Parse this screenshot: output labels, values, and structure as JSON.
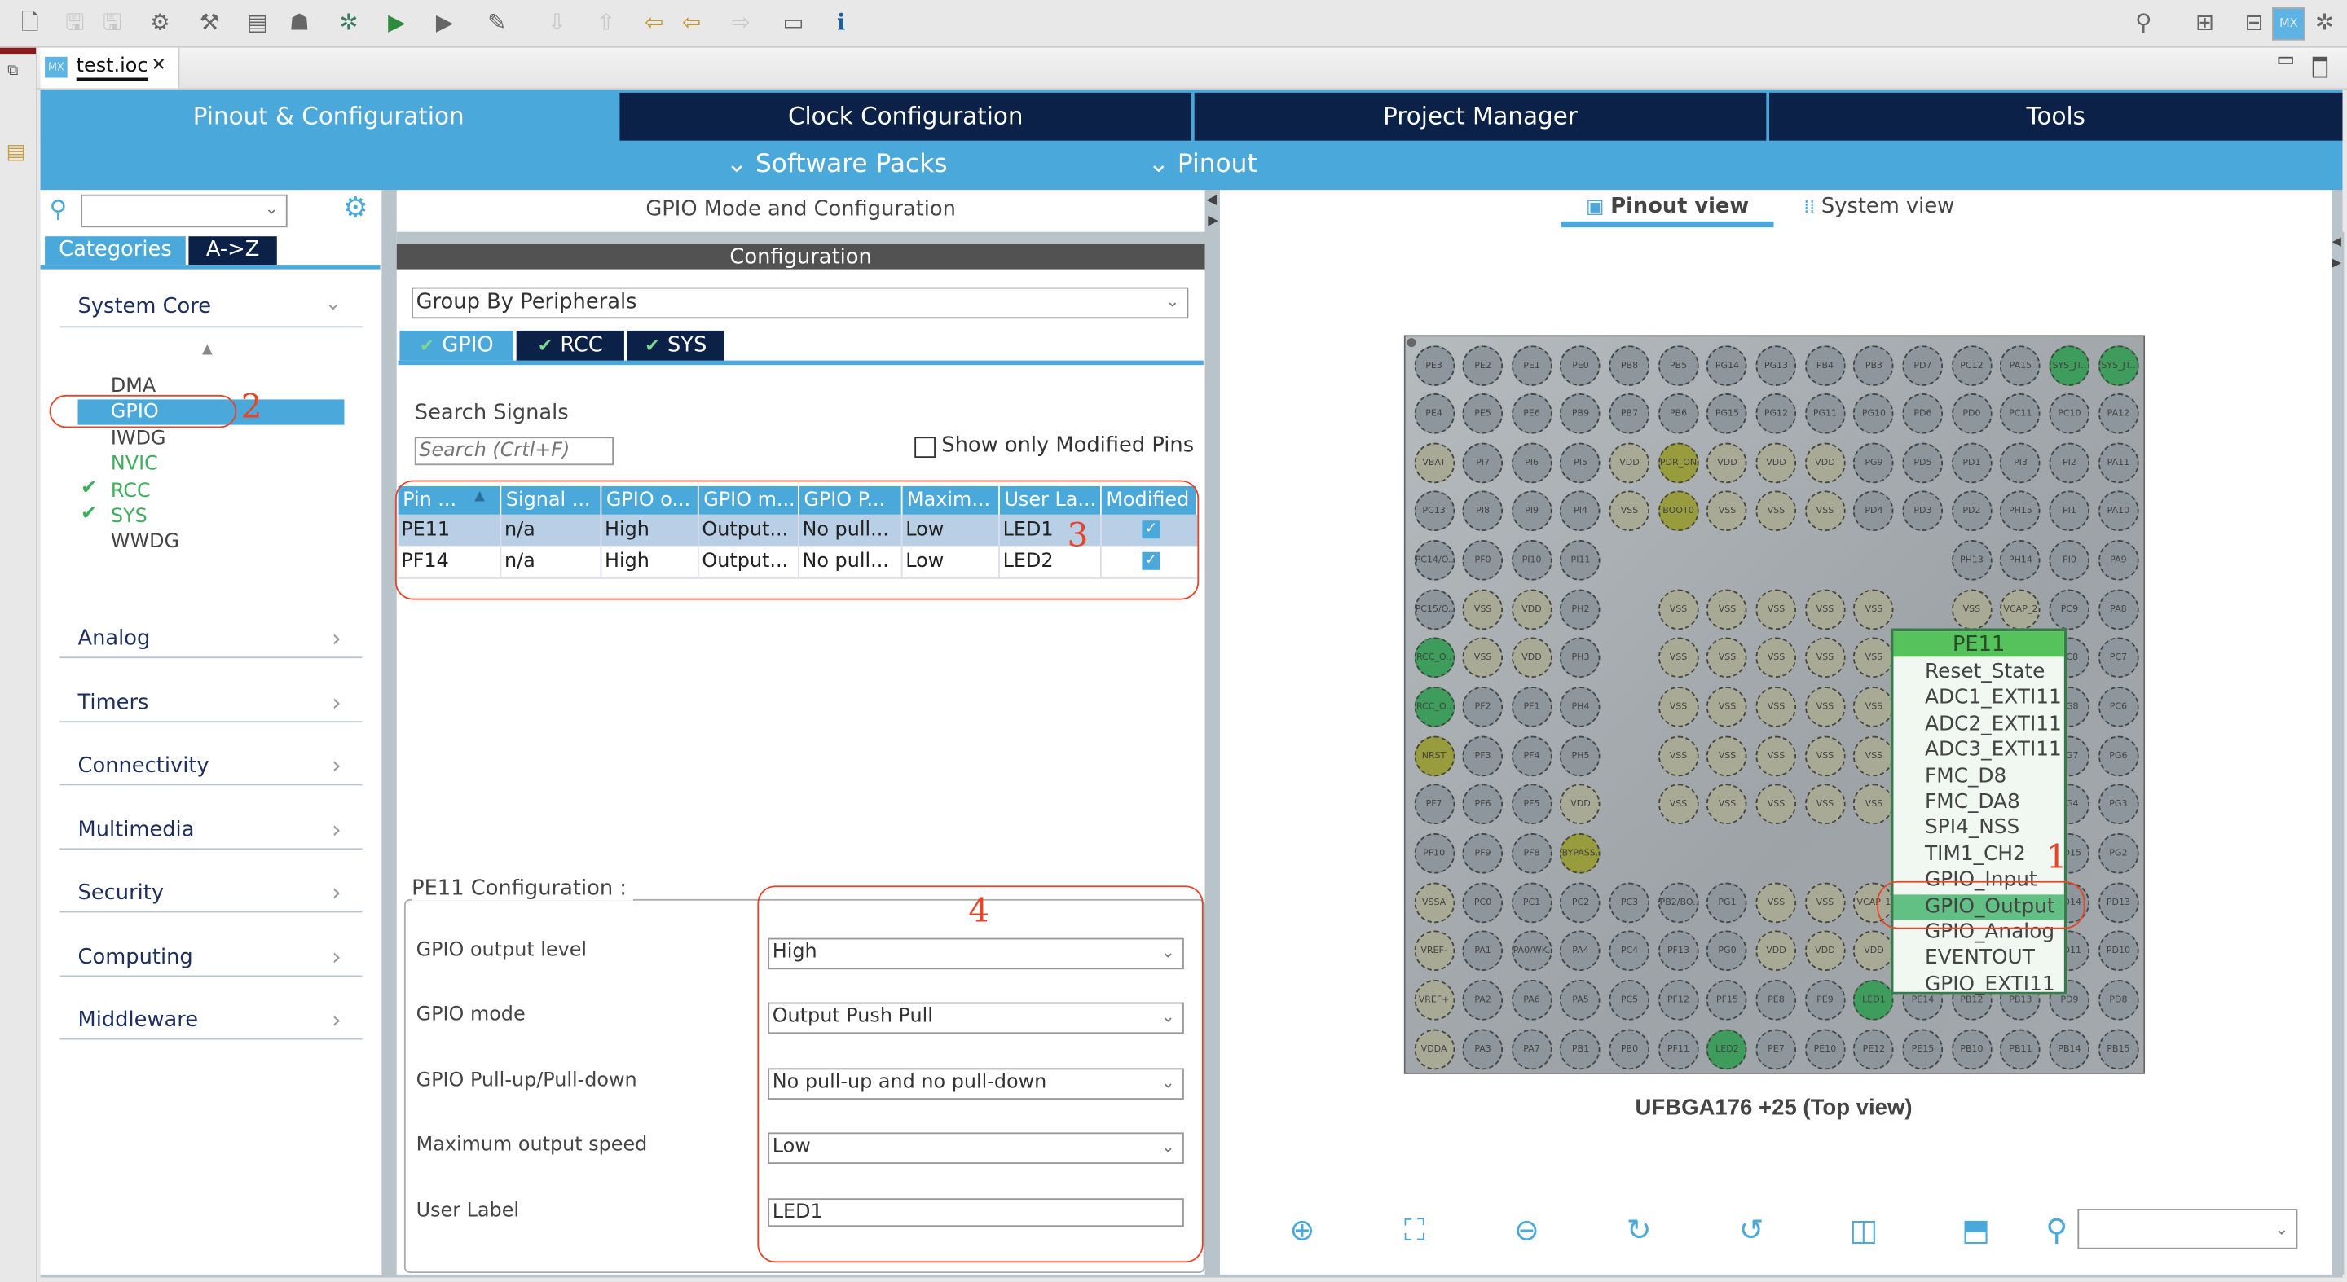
{
  "toolbar": {
    "icons": [
      "new-icon",
      "save-icon",
      "save-all-icon",
      "build-config-icon",
      "hammer-icon",
      "binary-icon",
      "toggle-icon",
      "debug-icon",
      "run-icon",
      "external-tools-icon",
      "pen-icon",
      "next-annotation-icon",
      "prev-annotation-icon",
      "last-edit-icon",
      "back-icon",
      "forward-icon",
      "open-perspective-icon",
      "info-icon"
    ],
    "right_icons": [
      "search-icon",
      "perspective-icon",
      "cpp-perspective-icon",
      "mx-perspective-icon",
      "debug-perspective-icon"
    ]
  },
  "editor_tab": {
    "badge": "MX",
    "title": "test.ioc"
  },
  "nav": {
    "tabs": [
      {
        "label": "Pinout & Configuration",
        "active": true
      },
      {
        "label": "Clock Configuration",
        "active": false
      },
      {
        "label": "Project Manager",
        "active": false
      },
      {
        "label": "Tools",
        "active": false
      }
    ],
    "sub": {
      "software_packs": "Software Packs",
      "pinout": "Pinout"
    }
  },
  "left": {
    "search_value": "",
    "tabs": {
      "categories": "Categories",
      "az": "A->Z"
    },
    "system_core": {
      "label": "System Core",
      "items": [
        {
          "label": "DMA",
          "checked": false,
          "green": false
        },
        {
          "label": "GPIO",
          "checked": false,
          "green": false,
          "selected": true
        },
        {
          "label": "IWDG",
          "checked": false,
          "green": false
        },
        {
          "label": "NVIC",
          "checked": false,
          "green": true
        },
        {
          "label": "RCC",
          "checked": true,
          "green": true
        },
        {
          "label": "SYS",
          "checked": true,
          "green": true
        },
        {
          "label": "WWDG",
          "checked": false,
          "green": false
        }
      ]
    },
    "categories": [
      "Analog",
      "Timers",
      "Connectivity",
      "Multimedia",
      "Security",
      "Computing",
      "Middleware"
    ]
  },
  "middle": {
    "title": "GPIO Mode and Configuration",
    "config_header": "Configuration",
    "group_by": "Group By Peripherals",
    "tabs": [
      {
        "label": "GPIO",
        "active": true
      },
      {
        "label": "RCC",
        "active": false
      },
      {
        "label": "SYS",
        "active": false
      }
    ],
    "search_label": "Search Signals",
    "search_placeholder": "Search (Crtl+F)",
    "show_modified_label": "Show only Modified Pins",
    "show_modified_checked": false,
    "table": {
      "columns": [
        "Pin ...",
        "Signal ...",
        "GPIO o...",
        "GPIO m...",
        "GPIO P...",
        "Maxim...",
        "User La...",
        "Modified"
      ],
      "rows": [
        {
          "cells": [
            "PE11",
            "n/a",
            "High",
            "Output...",
            "No pull...",
            "Low",
            "LED1"
          ],
          "modified": true,
          "selected": true
        },
        {
          "cells": [
            "PF14",
            "n/a",
            "High",
            "Output...",
            "No pull...",
            "Low",
            "LED2"
          ],
          "modified": true,
          "selected": false
        }
      ]
    },
    "pin_config": {
      "legend": "PE11 Configuration :",
      "fields": [
        {
          "label": "GPIO output level",
          "value": "High",
          "type": "select"
        },
        {
          "label": "GPIO mode",
          "value": "Output Push Pull",
          "type": "select"
        },
        {
          "label": "GPIO Pull-up/Pull-down",
          "value": "No pull-up and no pull-down",
          "type": "select"
        },
        {
          "label": "Maximum output speed",
          "value": "Low",
          "type": "select"
        },
        {
          "label": "User Label",
          "value": "LED1",
          "type": "text"
        }
      ]
    }
  },
  "annotations": [
    "1",
    "2",
    "3",
    "4"
  ],
  "right": {
    "tabs": {
      "pinout_view": "Pinout view",
      "system_view": "System view"
    },
    "package_label": "UFBGA176 +25 (Top view)",
    "bottom_icons": [
      "zoom-in-icon",
      "fit-icon",
      "zoom-out-icon",
      "rotate-right-icon",
      "rotate-left-icon",
      "flip-vertical-icon",
      "flip-horizontal-icon",
      "find-icon"
    ],
    "find_value": ""
  },
  "chip": {
    "colors": {
      "default": "#8c969c",
      "power": "#a9aa96",
      "special": "#989c3c",
      "assigned": "#3e9c5c",
      "background": "#a4aaad"
    },
    "assigned_pins": [
      "SYS_JT..",
      "RCC_O..",
      "LED1",
      "LED2"
    ],
    "special_pins": [
      "PDR_ON",
      "BOOT0",
      "NRST",
      "BYPASS.."
    ],
    "rows": [
      [
        "PE3",
        "PE2",
        "PE1",
        "PE0",
        "PB8",
        "PB5",
        "PG14",
        "PG13",
        "PB4",
        "PB3",
        "PD7",
        "PC12",
        "PA15",
        "SYS_JT..",
        "SYS_JT.."
      ],
      [
        "PE4",
        "PE5",
        "PE6",
        "PB9",
        "PB7",
        "PB6",
        "PG15",
        "PG12",
        "PG11",
        "PG10",
        "PD6",
        "PD0",
        "PC11",
        "PC10",
        "PA12"
      ],
      [
        "VBAT",
        "PI7",
        "PI6",
        "PI5",
        "VDD",
        "PDR_ON",
        "VDD",
        "VDD",
        "VDD",
        "PG9",
        "PD5",
        "PD1",
        "PI3",
        "PI2",
        "PA11"
      ],
      [
        "PC13",
        "PI8",
        "PI9",
        "PI4",
        "VSS",
        "BOOT0",
        "VSS",
        "VSS",
        "VSS",
        "PD4",
        "PD3",
        "PD2",
        "PH15",
        "PI1",
        "PA10"
      ],
      [
        "PC14/O..",
        "PF0",
        "PI10",
        "PI11",
        "",
        "",
        "",
        "",
        "",
        "",
        "",
        "PH13",
        "PH14",
        "PI0",
        "PA9"
      ],
      [
        "PC15/O..",
        "VSS",
        "VDD",
        "PH2",
        "",
        "VSS",
        "VSS",
        "VSS",
        "VSS",
        "VSS",
        "",
        "VSS",
        "VCAP_2",
        "PC9",
        "PA8"
      ],
      [
        "RCC_O..",
        "VSS",
        "VDD",
        "PH3",
        "",
        "VSS",
        "VSS",
        "VSS",
        "VSS",
        "VSS",
        null,
        null,
        null,
        "PC8",
        "PC7"
      ],
      [
        "RCC_O..",
        "PF2",
        "PF1",
        "PH4",
        "",
        "VSS",
        "VSS",
        "VSS",
        "VSS",
        "VSS",
        null,
        null,
        null,
        "PG8",
        "PC6"
      ],
      [
        "NRST",
        "PF3",
        "PF4",
        "PH5",
        "",
        "VSS",
        "VSS",
        "VSS",
        "VSS",
        "VSS",
        null,
        null,
        null,
        "PG7",
        "PG6"
      ],
      [
        "PF7",
        "PF6",
        "PF5",
        "VDD",
        "",
        "VSS",
        "VSS",
        "VSS",
        "VSS",
        "VSS",
        null,
        null,
        null,
        "PG4",
        "PG3"
      ],
      [
        "PF10",
        "PF9",
        "PF8",
        "BYPASS..",
        "",
        "",
        "",
        "",
        "",
        "",
        null,
        null,
        null,
        "PD15",
        "PG2"
      ],
      [
        "VSSA",
        "PC0",
        "PC1",
        "PC2",
        "PC3",
        "PB2/BO..",
        "PG1",
        "VSS",
        "VSS",
        "VCAP_1",
        null,
        null,
        null,
        "PD14",
        "PD13"
      ],
      [
        "VREF-",
        "PA1",
        "PA0/WK..",
        "PA4",
        "PC4",
        "PF13",
        "PG0",
        "VDD",
        "VDD",
        "VDD",
        null,
        null,
        null,
        "PD11",
        "PD10"
      ],
      [
        "VREF+",
        "PA2",
        "PA6",
        "PA5",
        "PC5",
        "PF12",
        "PF15",
        "PE8",
        "PE9",
        "LED1",
        "PE14",
        "PB12",
        "PB13",
        "PD9",
        "PD8"
      ],
      [
        "VDDA",
        "PA3",
        "PA7",
        "PB1",
        "PB0",
        "PF11",
        "LED2",
        "PE7",
        "PE10",
        "PE12",
        "PE15",
        "PB10",
        "PB11",
        "PB14",
        "PB15"
      ]
    ],
    "popup": {
      "title": "PE11",
      "items": [
        "Reset_State",
        "ADC1_EXTI11",
        "ADC2_EXTI11",
        "ADC3_EXTI11",
        "FMC_D8",
        "FMC_DA8",
        "SPI4_NSS",
        "TIM1_CH2",
        "GPIO_Input",
        "GPIO_Output",
        "GPIO_Analog",
        "EVENTOUT",
        "GPIO_EXTI11"
      ],
      "selected": "GPIO_Output"
    }
  }
}
